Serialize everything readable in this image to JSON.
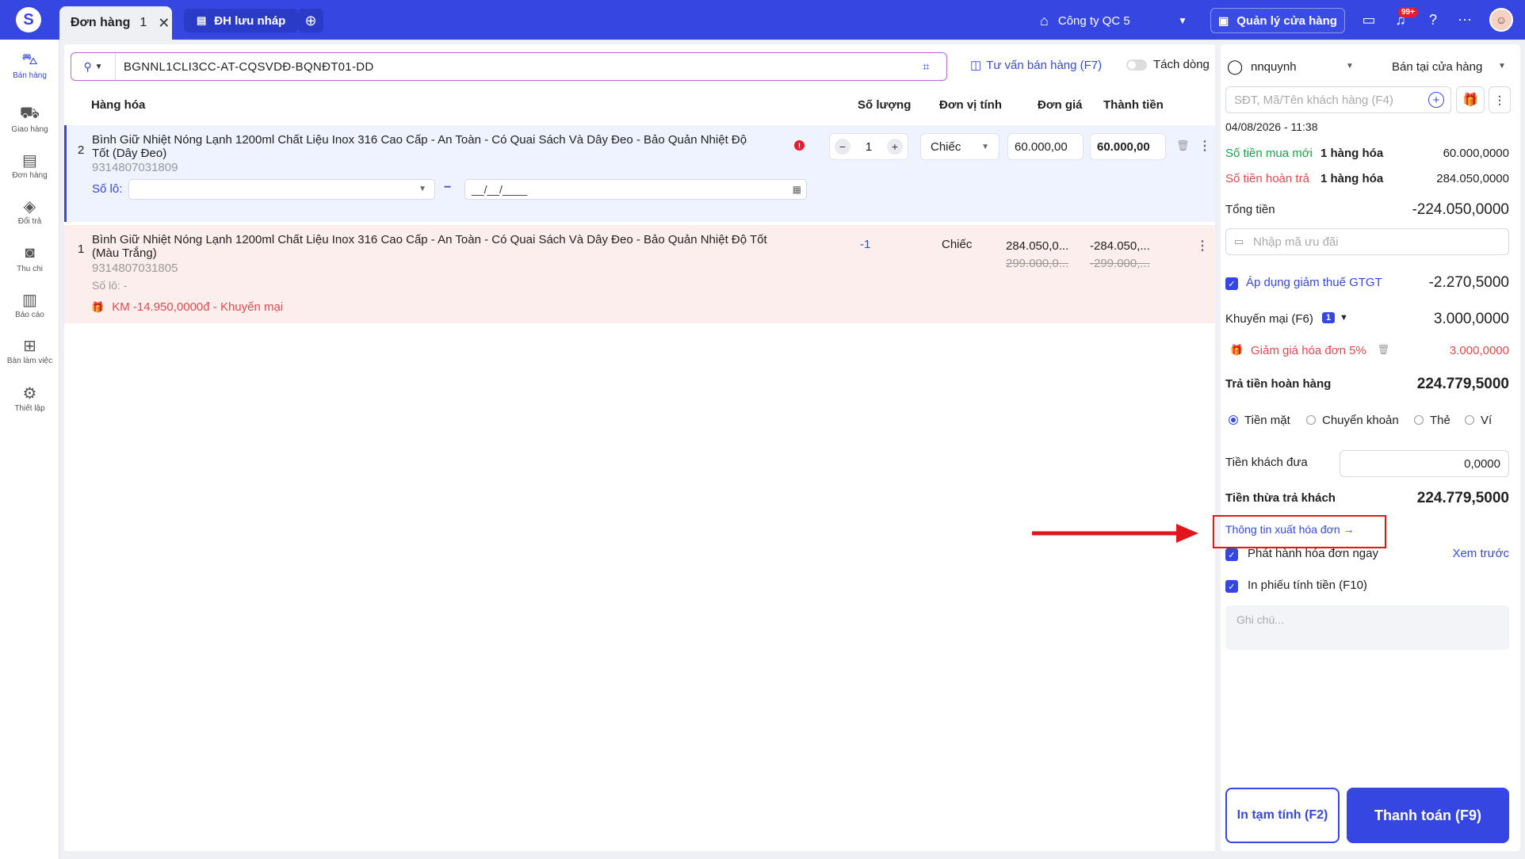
{
  "topbar": {
    "tabs": [
      {
        "label": "Đơn hàng",
        "count": "1",
        "close": "✕"
      },
      {
        "label": "ĐH lưu nháp"
      }
    ],
    "add_tab": "⊕",
    "company": "Công ty QC 5",
    "store_button": "Quản lý cửa hàng",
    "notification_badge": "99+",
    "accent_color": "#3547e0"
  },
  "sidebar": {
    "items": [
      {
        "label": "Bán hàng",
        "icon": "shopping-bag-icon"
      },
      {
        "label": "Giao hàng",
        "icon": "truck-icon"
      },
      {
        "label": "Đơn hàng",
        "icon": "clipboard-icon"
      },
      {
        "label": "Đổi trả",
        "icon": "box-return-icon"
      },
      {
        "label": "Thu chi",
        "icon": "cash-icon"
      },
      {
        "label": "Báo cáo",
        "icon": "bar-chart-icon"
      },
      {
        "label": "Bàn làm việc",
        "icon": "grid-icon"
      },
      {
        "label": "Thiết lập",
        "icon": "gear-icon"
      }
    ]
  },
  "search": {
    "value": "BGNNL1CLI3CC-AT-CQSVDĐ-BQNĐT01-DD"
  },
  "toolbar": {
    "advise_label": "Tư vấn bán hàng (F7)",
    "split_label": "Tách dòng"
  },
  "table": {
    "headers": {
      "product": "Hàng hóa",
      "qty": "Số lượng",
      "unit": "Đơn vị tính",
      "price": "Đơn giá",
      "total": "Thành tiền"
    },
    "rows": [
      {
        "index": "2",
        "name_line1": "Bình Giữ Nhiệt Nóng Lạnh 1200ml Chất Liệu Inox 316 Cao Cấp - An Toàn - Có Quai Sách Và Dây Đeo - Bảo Quản Nhiệt Độ",
        "name_line2": "Tốt (Dây Đeo)",
        "sku": "9314807031809",
        "warning": "!",
        "minus": "−",
        "qty": "1",
        "plus": "+",
        "unit": "Chiếc",
        "price": "60.000,00",
        "total": "60.000,00",
        "lot_label": "Số lô:",
        "date_placeholder": "__/__/____"
      },
      {
        "index": "1",
        "name_line1": "Bình Giữ Nhiệt Nóng Lạnh 1200ml Chất Liệu Inox 316 Cao Cấp - An Toàn - Có Quai Sách Và Dây Đeo - Bảo Quản Nhiệt Độ Tốt",
        "name_line2": "(Màu Trắng)",
        "sku": "9314807031805",
        "qty": "-1",
        "unit": "Chiếc",
        "price": "284.050,0...",
        "price_old": "299.000,0...",
        "total": "-284.050,...",
        "total_old": "-299.000,...",
        "lot": "Số lô: -",
        "promo": "KM -14.950,0000đ - Khuyến mại"
      }
    ]
  },
  "panel": {
    "user": "nnquynh",
    "sale_type": "Bán tại cửa hàng",
    "customer_placeholder": "SĐT, Mã/Tên khách hàng (F4)",
    "datetime": "04/08/2026 - 11:38",
    "new_purchase_label": "Số tiền mua mới",
    "new_purchase_count": "1 hàng hóa",
    "new_purchase_value": "60.000,0000",
    "refund_label": "Số tiền hoàn trả",
    "refund_count": "1 hàng hóa",
    "refund_value": "284.050,0000",
    "total_label": "Tổng tiền",
    "total_value": "-224.050,0000",
    "coupon_placeholder": "Nhập mã ưu đãi",
    "vat_label": "Áp dụng giảm thuế GTGT",
    "vat_value": "-2.270,5000",
    "promo_label": "Khuyến mại (F6)",
    "promo_count": "1",
    "promo_value": "3.000,0000",
    "promo_item_label": "Giảm giá hóa đơn 5%",
    "promo_item_value": "3.000,0000",
    "refund_pay_label": "Trả tiền hoàn hàng",
    "refund_pay_value": "224.779,5000",
    "payment_methods": [
      "Tiền mặt",
      "Chuyển khoản",
      "Thẻ",
      "Ví"
    ],
    "given_label": "Tiền khách đưa",
    "given_value": "0,0000",
    "change_label": "Tiền thừa trả khách",
    "change_value": "224.779,5000",
    "invoice_link": "Thông tin xuất hóa đơn →",
    "issue_now_label": "Phát hành hóa đơn ngay",
    "preview_link": "Xem trước",
    "print_receipt_label": "In phiếu tính tiền (F10)",
    "note_placeholder": "Ghi chú...",
    "print_temp_button": "In tạm tính (F2)",
    "pay_button": "Thanh toán (F9)"
  }
}
